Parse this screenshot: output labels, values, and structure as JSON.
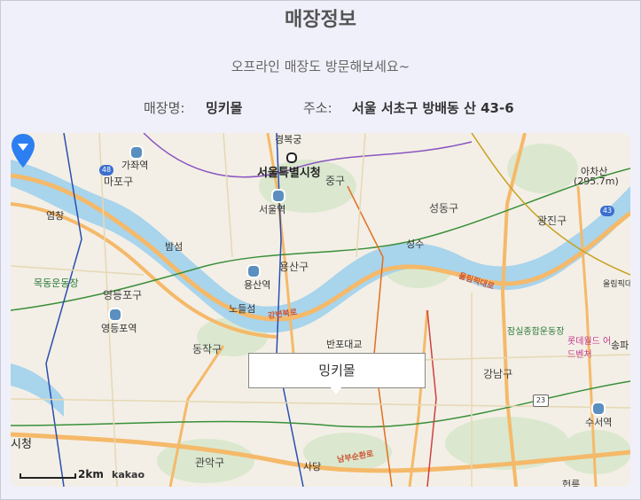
{
  "page": {
    "title": "매장정보",
    "subtitle": "오프라인 매장도 방문해보세요~"
  },
  "store": {
    "name_label": "매장명:",
    "name": "밍키몰",
    "address_label": "주소:",
    "address": "서울 서초구 방배동 산 43-6"
  },
  "map": {
    "info_window_text": "밍키몰",
    "scale_text": "2km",
    "provider": "kakao",
    "labels": {
      "city_hall": "서울특별시청",
      "gajwa": "가좌역",
      "mapo": "마포구",
      "jung": "중구",
      "seoul_station": "서울역",
      "seongdong": "성동구",
      "gwangjin": "광진구",
      "achasan": "아차산",
      "achasan_height": "(295.7m)",
      "bamseom": "밤섬",
      "yongsan": "용산구",
      "yongsan_station": "용산역",
      "seongsu": "성수",
      "mokdong": "목동운동장",
      "yeongdeungpo": "영등포구",
      "yeongdeungpo_station": "영등포역",
      "nodeulseom": "노들섬",
      "dongjak": "동작구",
      "banpo": "반포대교",
      "gangnam": "강남구",
      "jamsil": "잠실종합운동장",
      "lotte": "롯데월드 어드벤처",
      "songpa": "송파",
      "suseo": "수서역",
      "olympic": "올림픽대교",
      "gwanak": "관악구",
      "sadang": "사당",
      "gyeongbok": "경복궁",
      "yeomchang": "염창",
      "siheung": "시청",
      "heolleung": "헌릉",
      "gangbyeon_road": "강변북로",
      "olympic_road": "올림픽대로",
      "nambu_road": "남부순환로",
      "route23": "23",
      "route48": "48",
      "route43": "43"
    }
  },
  "colors": {
    "background": "#f0f0fb",
    "river": "#a8d4ec",
    "highway": "#f5b96a",
    "marker": "#2d7ef0"
  }
}
